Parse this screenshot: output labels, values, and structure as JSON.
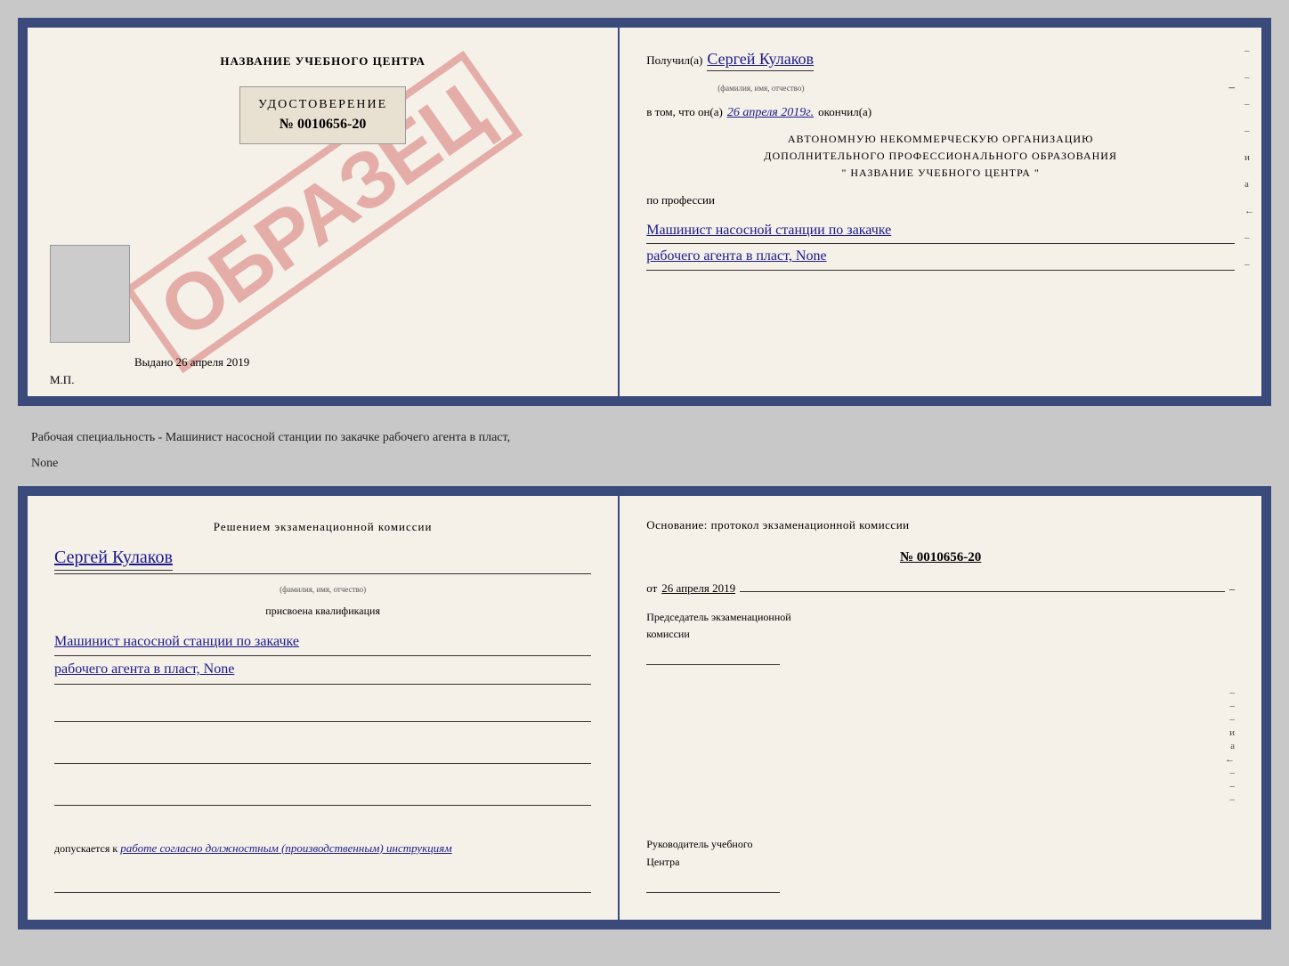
{
  "page": {
    "background": "#c0c8d8"
  },
  "topDoc": {
    "left": {
      "title": "НАЗВАНИЕ УЧЕБНОГО ЦЕНТРА",
      "watermark": "ОБРАЗЕЦ",
      "udostoverenie": {
        "label": "УДОСТОВЕРЕНИЕ",
        "number": "№ 0010656-20"
      },
      "vydano": "Выдано 26 апреля 2019",
      "mp": "М.П."
    },
    "right": {
      "poluchil_label": "Получил(а)",
      "recipient_name": "Сергей Кулаков",
      "fio_label": "(фамилия, имя, отчество)",
      "vtom_label": "в том, что он(а)",
      "date": "26 апреля 2019г.",
      "okonchil_label": "окончил(а)",
      "org_line1": "АВТОНОМНУЮ НЕКОММЕРЧЕСКУЮ ОРГАНИЗАЦИЮ",
      "org_line2": "ДОПОЛНИТЕЛЬНОГО ПРОФЕССИОНАЛЬНОГО ОБРАЗОВАНИЯ",
      "org_line3": "\"  НАЗВАНИЕ УЧЕБНОГО ЦЕНТРА  \"",
      "po_professii": "по профессии",
      "profession1": "Машинист насосной станции по закачке",
      "profession2": "рабочего агента в пласт, None",
      "dashes": [
        "-",
        "-",
        "-",
        "-",
        "и",
        "а",
        "←",
        "-",
        "-"
      ]
    }
  },
  "separator": {
    "text": "Рабочая специальность - Машинист насосной станции по закачке рабочего агента в пласт,",
    "text2": "None"
  },
  "bottomDoc": {
    "left": {
      "resheniem": "Решением  экзаменационной  комиссии",
      "name": "Сергей Кулаков",
      "fio_label": "(фамилия, имя, отчество)",
      "prisvoyena": "присвоена квалификация",
      "profession1": "Машинист насосной станции по закачке",
      "profession2": "рабочего агента в пласт, None",
      "dopuskaetsya_label": "допускается к",
      "dopuskaetsya_text": "работе согласно должностным (производственным) инструкциям"
    },
    "right": {
      "osnovanie": "Основание: протокол экзаменационной  комиссии",
      "protocol_number": "№  0010656-20",
      "ot_label": "от",
      "ot_date": "26 апреля 2019",
      "predsedatel_label": "Председатель экзаменационной",
      "komissia_label": "комиссии",
      "rukovoditel_label": "Руководитель учебного",
      "centr_label": "Центра",
      "dashes": [
        "-",
        "-",
        "-",
        "-",
        "и",
        "а",
        "←",
        "-",
        "-"
      ]
    }
  }
}
